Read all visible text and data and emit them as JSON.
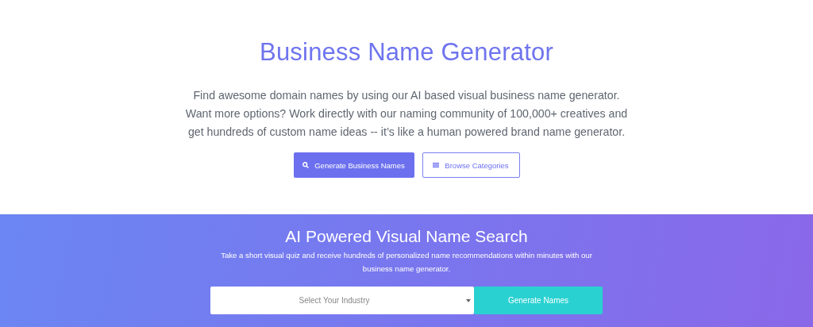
{
  "hero": {
    "title": "Business Name Generator",
    "description": "Find awesome domain names by using our AI based visual business name generator. Want more options? Work directly with our naming community of 100,000+ creatives and get hundreds of custom name ideas -- it’s like a human powered brand name generator.",
    "buttons": [
      {
        "label": "Generate Business Names",
        "kind": "primary"
      },
      {
        "label": "Browse Categories",
        "kind": "outline"
      }
    ]
  },
  "search_band": {
    "title": "AI Powered Visual Name Search",
    "description": "Take a short visual quiz and receive hundreds of personalized name recommendations within minutes with our business name generator.",
    "industry_select": {
      "placeholder": "Select Your Industry"
    },
    "button": "Generate Names"
  }
}
